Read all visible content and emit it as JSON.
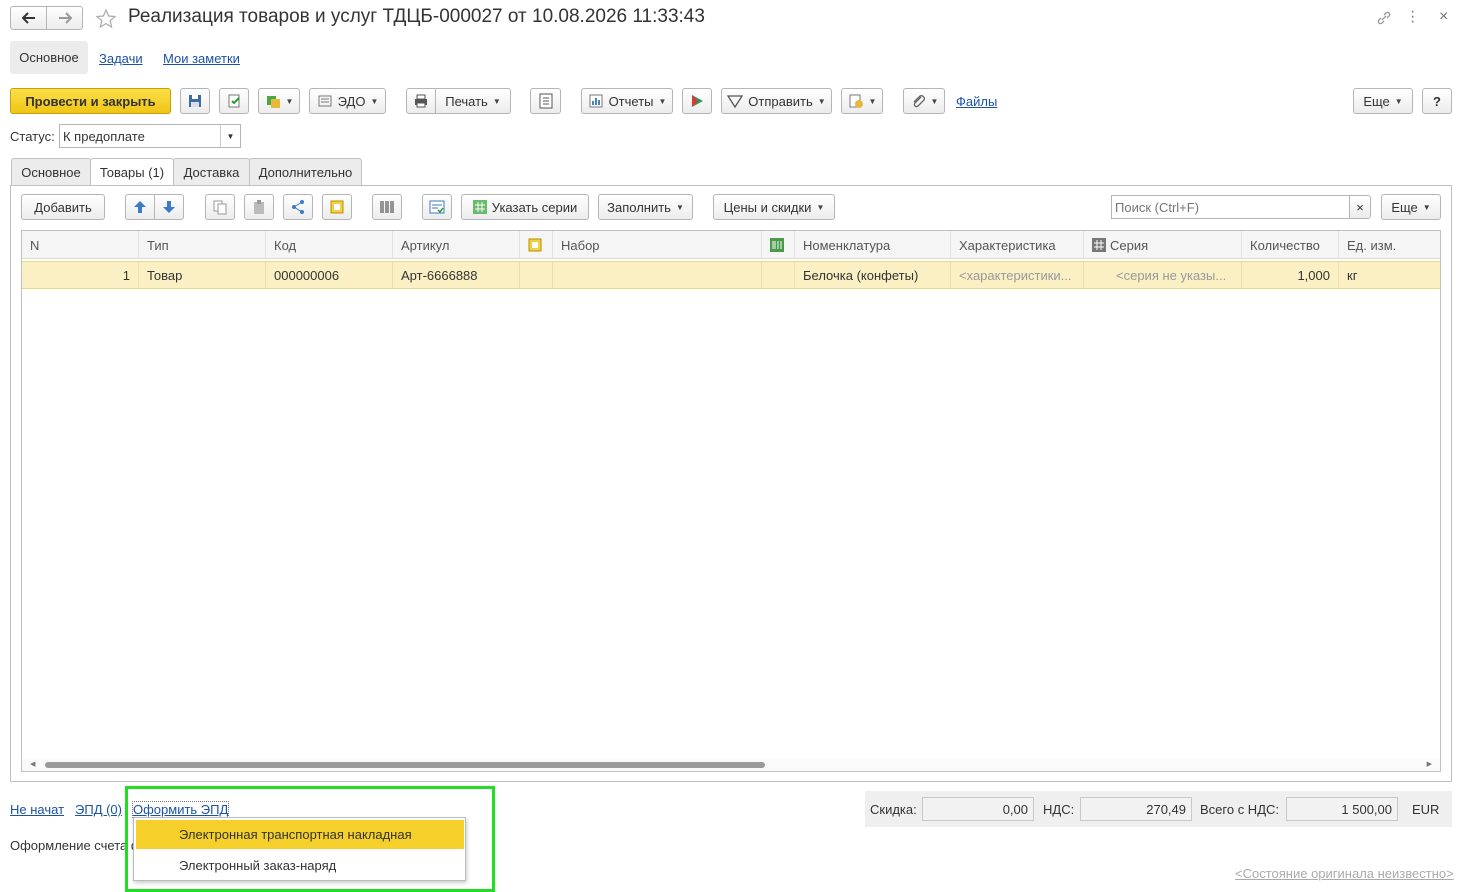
{
  "window": {
    "title": "Реализация товаров и услуг ТДЦБ-000027 от 10.08.2026 11:33:43"
  },
  "nav_tabs": [
    "Основное",
    "Задачи",
    "Мои заметки"
  ],
  "toolbar": {
    "post_close": "Провести и закрыть",
    "edo": "ЭДО",
    "print": "Печать",
    "reports": "Отчеты",
    "send": "Отправить",
    "files": "Файлы",
    "more": "Еще",
    "help": "?"
  },
  "status": {
    "label": "Статус:",
    "value": "К предоплате"
  },
  "doc_tabs": [
    "Основное",
    "Товары (1)",
    "Доставка",
    "Дополнительно"
  ],
  "table_toolbar": {
    "add": "Добавить",
    "series": "Указать серии",
    "fill": "Заполнить",
    "prices": "Цены и скидки",
    "search_placeholder": "Поиск (Ctrl+F)",
    "clear": "×",
    "more": "Еще"
  },
  "table": {
    "columns": [
      "N",
      "Тип",
      "Код",
      "Артикул",
      "",
      "Набор",
      "",
      "Номенклатура",
      "Характеристика",
      "Серия",
      "Количество",
      "Ед. изм."
    ],
    "rows": [
      [
        "1",
        "Товар",
        "000000006",
        "Арт-6666888",
        "",
        "",
        "",
        "Белочка (конфеты)",
        "<характеристики...",
        "<серия не указы...",
        "1,000",
        "кг"
      ]
    ]
  },
  "footer": {
    "status_link": "Не начат",
    "epd_link": "ЭПД (0)",
    "make_epd_link": "Оформить ЭПД",
    "invoice_text": "Оформление счета ф",
    "original_state": "<Состояние оригинала неизвестно>",
    "discount_label": "Скидка:",
    "discount_value": "0,00",
    "vat_label": "НДС:",
    "vat_value": "270,49",
    "total_label": "Всего с НДС:",
    "total_value": "1 500,00",
    "currency": "EUR"
  },
  "dropdown": {
    "items": [
      "Электронная транспортная накладная",
      "Электронный заказ-наряд"
    ]
  },
  "colors": {
    "accent_yellow": "#f5cf2a",
    "selected_row": "#fbf0c4",
    "highlight_border": "#22dd22",
    "link": "#1a52a6"
  }
}
